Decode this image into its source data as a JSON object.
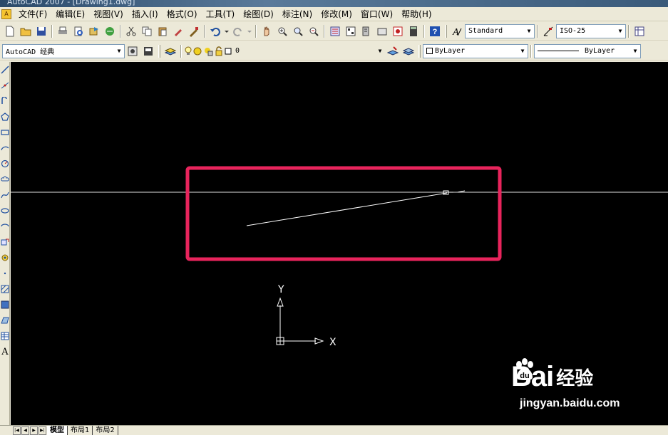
{
  "window": {
    "title": "AutoCAD 2007 - [Drawing1.dwg]"
  },
  "menu": [
    {
      "label": "文件(F)"
    },
    {
      "label": "编辑(E)"
    },
    {
      "label": "视图(V)"
    },
    {
      "label": "插入(I)"
    },
    {
      "label": "格式(O)"
    },
    {
      "label": "工具(T)"
    },
    {
      "label": "绘图(D)"
    },
    {
      "label": "标注(N)"
    },
    {
      "label": "修改(M)"
    },
    {
      "label": "窗口(W)"
    },
    {
      "label": "帮助(H)"
    }
  ],
  "toolbar": {
    "text_style": "Standard",
    "dim_style": "ISO-25"
  },
  "toolbar2": {
    "workspace": "AutoCAD 经典",
    "layer": "0",
    "color": "ByLayer",
    "linetype": "ByLayer"
  },
  "canvas": {
    "background": "#000000",
    "highlight_color": "#e8245c",
    "ucs_y_label": "Y",
    "ucs_x_label": "X"
  },
  "tabs": [
    {
      "label": "模型",
      "active": true
    },
    {
      "label": "布局1",
      "active": false
    },
    {
      "label": "布局2",
      "active": false
    }
  ],
  "watermark": {
    "brand": "Bai",
    "brand_suffix": "经验",
    "url": "jingyan.baidu.com"
  }
}
